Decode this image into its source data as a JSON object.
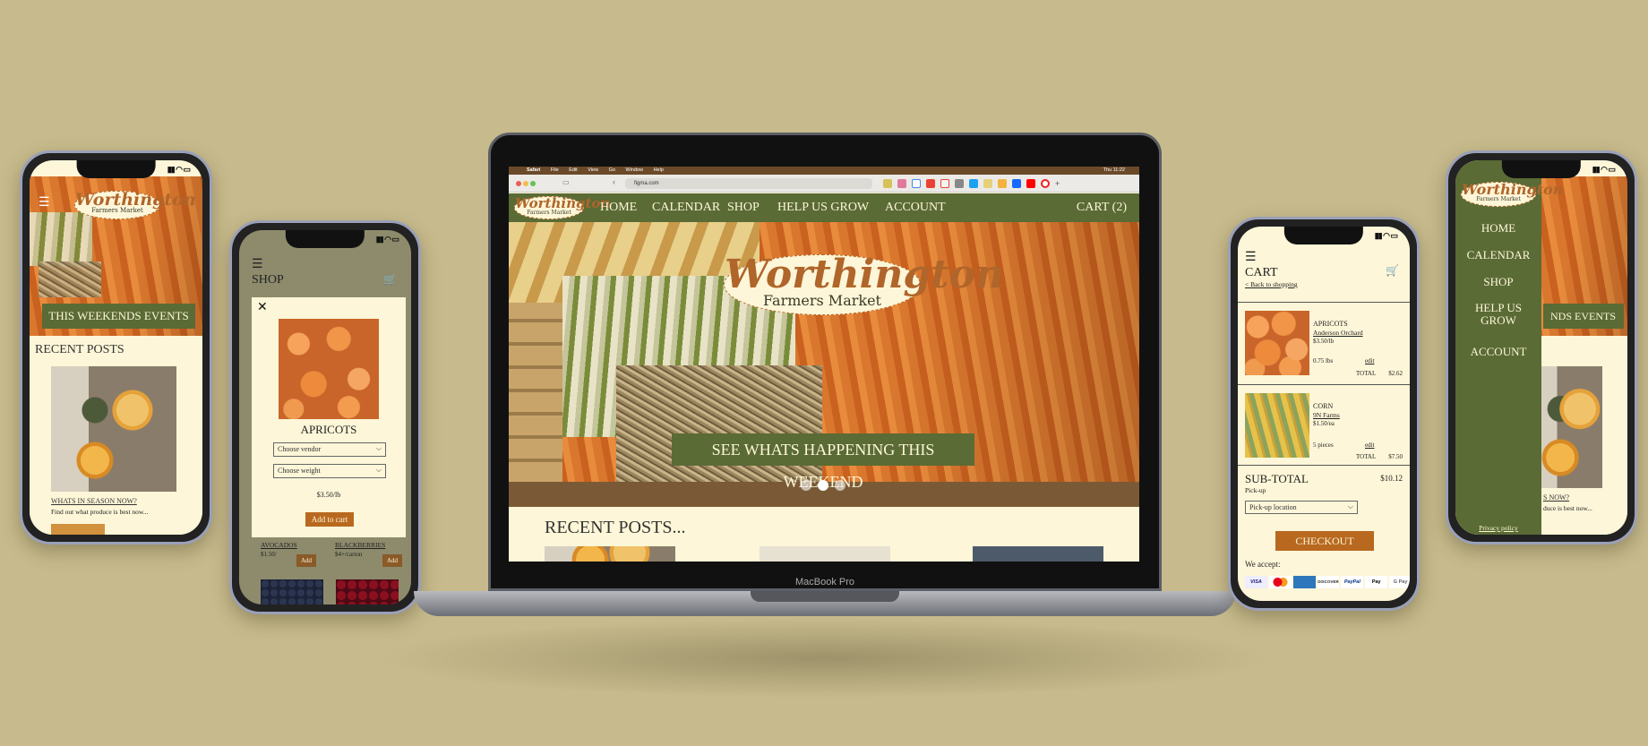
{
  "brand": {
    "logo_script": "Worthington",
    "logo_sub": "Farmers Market"
  },
  "phone1": {
    "events_button": "THIS WEEKENDS EVENTS",
    "recent_posts_heading": "RECENT POSTS",
    "post_title": "WHATS IN SEASON NOW?",
    "post_excerpt": "Find out what produce is best now..."
  },
  "phone2": {
    "page_title": "SHOP",
    "modal": {
      "product_name": "APRICOTS",
      "vendor_select": "Choose vendor",
      "weight_select": "Choose weight",
      "price": "$3.50/lb",
      "add_button": "Add to cart"
    },
    "grid": [
      {
        "name": "AVOCADOS",
        "price": "$1.50/",
        "button": "Add"
      },
      {
        "name": "BLACKBERRIES",
        "price": "$4+/carton",
        "button": "Add"
      }
    ]
  },
  "laptop": {
    "menubar": [
      "Safari",
      "File",
      "Edit",
      "View",
      "Go",
      "Window",
      "Help"
    ],
    "clock": "Thu 11:22",
    "address": "figma.com",
    "nav": [
      "HOME",
      "CALENDAR",
      "SHOP",
      "HELP US GROW",
      "ACCOUNT"
    ],
    "cart": "CART (2)",
    "hero_button": "SEE WHATS HAPPENING THIS WEEKEND",
    "carousel": {
      "count": 3,
      "active": 2
    },
    "recent_posts": "RECENT POSTS...",
    "label": "MacBook Pro"
  },
  "phone3": {
    "title": "CART",
    "back_link": "< Back to shopping",
    "items": [
      {
        "name": "APRICOTS",
        "vendor": "Anderson Orchard",
        "unit_price": "$3.50/lb",
        "qty": "0.75 lbs",
        "edit": "edit",
        "total_label": "TOTAL",
        "total": "$2.62"
      },
      {
        "name": "CORN",
        "vendor": "9N Farms",
        "unit_price": "$1.50/ea",
        "qty": "5 pieces",
        "edit": "edit",
        "total_label": "TOTAL",
        "total": "$7.50"
      }
    ],
    "subtotal_label": "SUB-TOTAL",
    "subtotal": "$10.12",
    "pickup_label": "Pick-up",
    "pickup_select": "Pick-up location",
    "checkout": "CHECKOUT",
    "we_accept": "We accept:",
    "payments": [
      "VISA",
      "Mastercard",
      "AMEX",
      "DISCOVER",
      "PayPal",
      "Apple Pay",
      "G Pay"
    ]
  },
  "phone4": {
    "menu": [
      "HOME",
      "CALENDAR",
      "SHOP",
      "HELP US GROW",
      "ACCOUNT"
    ],
    "privacy": "Privacy policy",
    "bg_events": "NDS EVENTS",
    "bg_post": "S NOW?",
    "bg_excerpt": "duce is best now..."
  },
  "colors": {
    "background": "#c7bb8d",
    "olive": "#5a6b35",
    "cream": "#fdf6d8",
    "orange": "#b8691f"
  }
}
